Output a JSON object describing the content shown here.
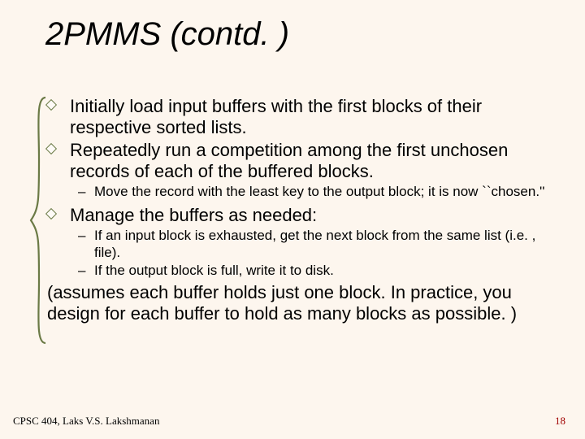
{
  "title": "2PMMS (contd. )",
  "bullets": {
    "b1": "Initially load input buffers with the first blocks of their respective sorted lists.",
    "b2": "Repeatedly run a competition among the first unchosen records of each of the buffered blocks.",
    "b2_sub1": "Move the record with the least key to the output block; it is now ``chosen.''",
    "b3": "Manage the buffers as needed:",
    "b3_sub1": "If an input block is exhausted, get the next block from the same list (i.e. , file).",
    "b3_sub2": "If the output block is full, write it to disk."
  },
  "paren": "(assumes each buffer holds just one block. In practice, you design for each buffer to hold as many blocks as possible. )",
  "footer": {
    "left": "CPSC 404, Laks V.S. Lakshmanan",
    "right": "18"
  },
  "brace_color": "#6b7a46"
}
